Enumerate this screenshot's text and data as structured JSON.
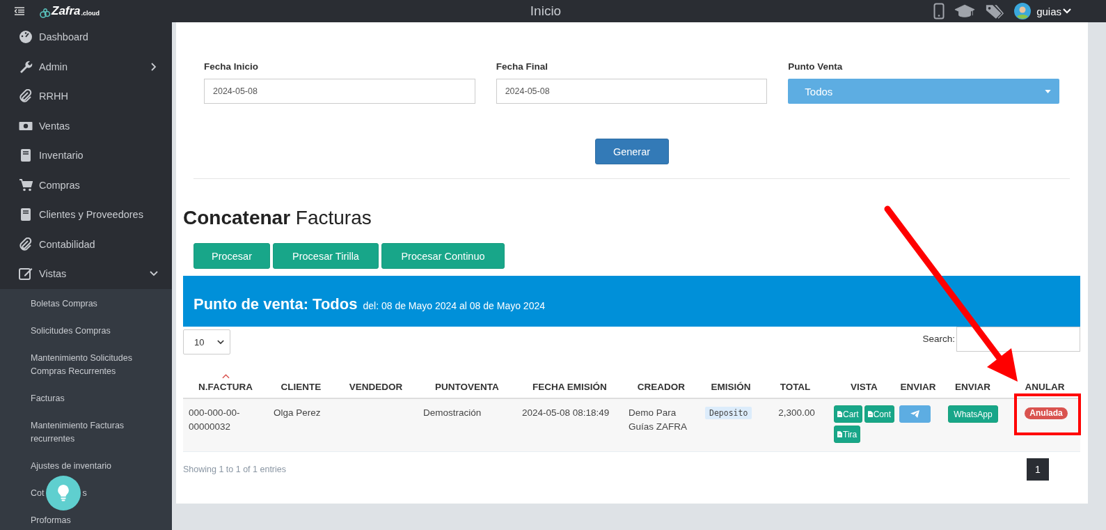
{
  "topbar": {
    "logo": {
      "main": "Zafra",
      "suffix": ".cloud"
    },
    "title": "Inicio",
    "user": "guias"
  },
  "sidebar": {
    "items": [
      {
        "label": "Dashboard",
        "kind": "gauge"
      },
      {
        "label": "Admin",
        "kind": "wrench",
        "expanded": false
      },
      {
        "label": "RRHH",
        "kind": "clip"
      },
      {
        "label": "Ventas",
        "kind": "money"
      },
      {
        "label": "Inventario",
        "kind": "book"
      },
      {
        "label": "Compras",
        "kind": "cart"
      },
      {
        "label": "Clientes y Proveedores",
        "kind": "book"
      },
      {
        "label": "Contabilidad",
        "kind": "clip"
      },
      {
        "label": "Vistas",
        "kind": "edit",
        "expanded": true,
        "children": [
          {
            "label": "Boletas Compras"
          },
          {
            "label": "Solicitudes Compras"
          },
          {
            "label": "Mantenimiento Solicitudes Compras Recurrentes"
          },
          {
            "label": "Facturas"
          },
          {
            "label": "Mantenimiento Facturas recurrentes"
          },
          {
            "label": "Ajustes de inventario"
          },
          {
            "label": "Cot",
            "label_end": "s"
          },
          {
            "label": "Proformas"
          }
        ]
      }
    ]
  },
  "filters": [
    {
      "label": "Fecha Inicio",
      "kind": "input",
      "value": "2024-05-08"
    },
    {
      "label": "Fecha Final",
      "kind": "input",
      "value": "2024-05-08"
    },
    {
      "label": "Punto Venta",
      "kind": "select",
      "value": "Todos"
    }
  ],
  "generate_button": "Generar",
  "heading": {
    "bold": "Concatenar",
    "rest": "Facturas"
  },
  "process_buttons": [
    "Procesar",
    "Procesar Tirilla",
    "Procesar Continuo"
  ],
  "banner": {
    "title": "Punto de venta: Todos",
    "subtitle": "del: 08 de Mayo 2024 al 08 de Mayo 2024"
  },
  "page_size": "10",
  "search": {
    "label": "Search:"
  },
  "table": {
    "columns": [
      {
        "label": "N.FACTURA",
        "sorted": true
      },
      {
        "label": "CLIENTE",
        "sorted": false
      },
      {
        "label": "VENDEDOR",
        "sorted": false
      },
      {
        "label": "PUNTOVENTA",
        "sorted": false
      },
      {
        "label": "FECHA EMISIÓN",
        "sorted": false
      },
      {
        "label": "CREADOR",
        "sorted": false
      },
      {
        "label": "EMISIÓN",
        "sorted": false
      },
      {
        "label": "TOTAL",
        "sorted": false
      },
      {
        "label": "VISTA",
        "sorted": false
      },
      {
        "label": "ENVIAR",
        "sorted": false
      },
      {
        "label": "ENVIAR",
        "sorted": false
      },
      {
        "label": "ANULAR",
        "sorted": false
      }
    ],
    "rows": [
      {
        "factura": "000-000-00-00000032",
        "cliente": "Olga Perez",
        "puntoventa": "Demostración",
        "fecha": "2024-05-08 08:18:49",
        "creador": "Demo Para Guías ZAFRA",
        "emision": "Deposito",
        "total": "2,300.00",
        "vista": [
          "Cart",
          "Cont",
          "Tira"
        ],
        "whatsapp": "WhatsApp",
        "anular": "Anulada"
      }
    ]
  },
  "footer": {
    "info": "Showing 1 to 1 of 1 entries",
    "pages": [
      {
        "label": "1",
        "selected": true
      }
    ]
  }
}
